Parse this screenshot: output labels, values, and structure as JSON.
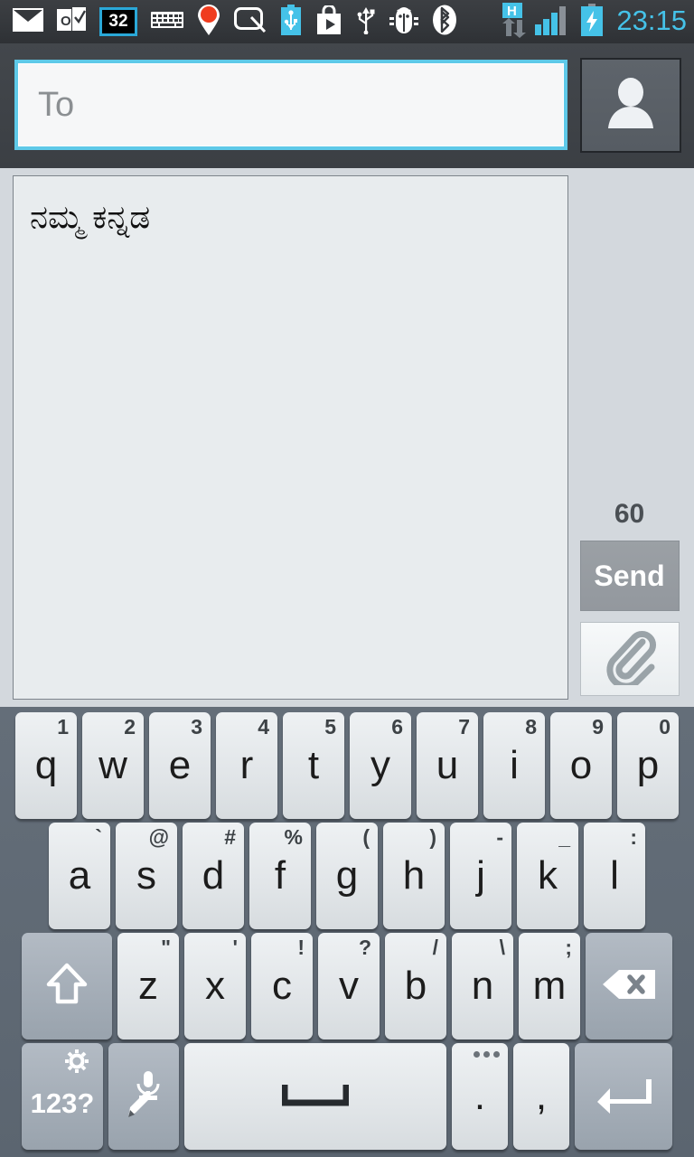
{
  "status_bar": {
    "clock": "23:15",
    "badge_count": "32",
    "icons": [
      "email-icon",
      "outlook-icon",
      "counter-32-icon",
      "keyboard-icon",
      "location-pin-icon",
      "screen-capture-icon",
      "usb-battery-icon",
      "play-store-icon",
      "usb-icon",
      "debug-bug-icon",
      "bluetooth-icon",
      "hspa-data-icon",
      "signal-bars-icon",
      "charging-battery-icon"
    ],
    "data_type_label": "H"
  },
  "compose": {
    "to_placeholder": "To",
    "to_value": "",
    "contact_picker_icon": "contact-person-icon",
    "message_text": "ನಮ್ಮ ಕನ್ನಡ",
    "char_counter": "60",
    "send_label": "Send",
    "attach_icon": "paperclip-icon"
  },
  "keyboard": {
    "row1": [
      {
        "main": "q",
        "sup": "1"
      },
      {
        "main": "w",
        "sup": "2"
      },
      {
        "main": "e",
        "sup": "3"
      },
      {
        "main": "r",
        "sup": "4"
      },
      {
        "main": "t",
        "sup": "5"
      },
      {
        "main": "y",
        "sup": "6"
      },
      {
        "main": "u",
        "sup": "7"
      },
      {
        "main": "i",
        "sup": "8"
      },
      {
        "main": "o",
        "sup": "9"
      },
      {
        "main": "p",
        "sup": "0"
      }
    ],
    "row2": [
      {
        "main": "a",
        "sup": "`"
      },
      {
        "main": "s",
        "sup": "@"
      },
      {
        "main": "d",
        "sup": "#"
      },
      {
        "main": "f",
        "sup": "%"
      },
      {
        "main": "g",
        "sup": "("
      },
      {
        "main": "h",
        "sup": ")"
      },
      {
        "main": "j",
        "sup": "-"
      },
      {
        "main": "k",
        "sup": "_"
      },
      {
        "main": "l",
        "sup": ":"
      }
    ],
    "row3": [
      {
        "main": "z",
        "sup": "\""
      },
      {
        "main": "x",
        "sup": "'"
      },
      {
        "main": "c",
        "sup": "!"
      },
      {
        "main": "v",
        "sup": "?"
      },
      {
        "main": "b",
        "sup": "/"
      },
      {
        "main": "n",
        "sup": "\\"
      },
      {
        "main": "m",
        "sup": ";"
      }
    ],
    "shift_icon": "shift-arrow-icon",
    "backspace_icon": "backspace-icon",
    "symbols_label": "123?",
    "symbols_icon": "gear-icon",
    "mic_icon": "microphone-pencil-icon",
    "space_icon": "spacebar-icon",
    "period": ".",
    "comma": ",",
    "enter_icon": "enter-arrow-icon"
  },
  "colors": {
    "accent_cyan": "#45c2e8",
    "focus_border": "#5ec9e8",
    "status_bar_bg": "#35383c",
    "header_bg": "#3f4348",
    "page_bg": "#d3d8dd",
    "message_bg": "#e8ecee",
    "keyboard_bg": "#5f6973",
    "key_bg": "#e4e8eb",
    "key_dark_bg": "#a6afb8",
    "send_bg": "#979ca2"
  }
}
